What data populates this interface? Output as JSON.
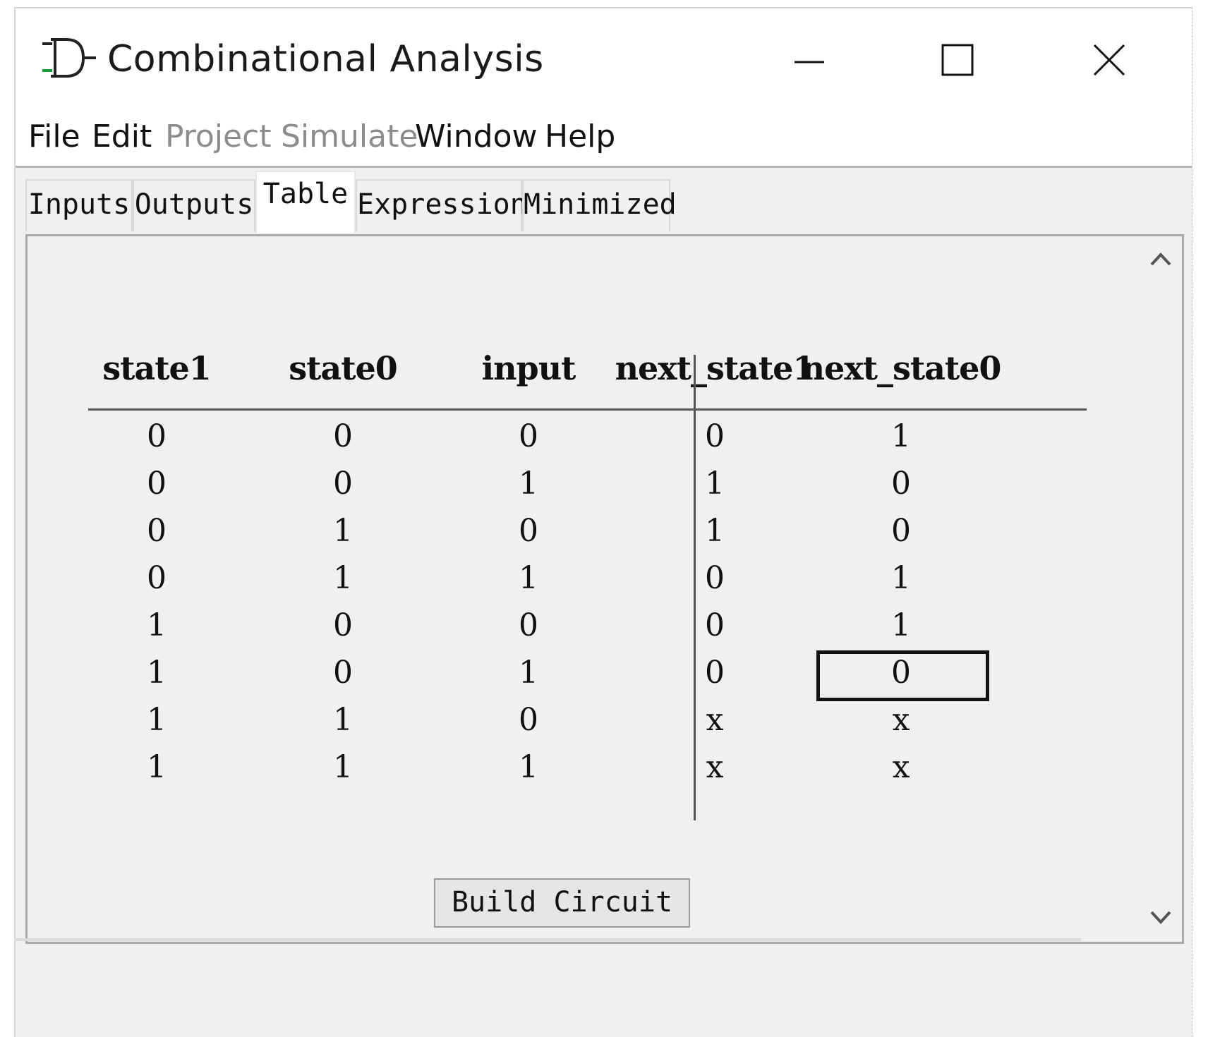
{
  "window": {
    "title": "Combinational Analysis",
    "icon": "gate-icon",
    "controls": [
      "minimize-icon",
      "maximize-icon",
      "close-icon"
    ]
  },
  "menubar": {
    "items": [
      {
        "label": "File",
        "enabled": true
      },
      {
        "label": "Edit",
        "enabled": true
      },
      {
        "label": "Project",
        "enabled": false
      },
      {
        "label": "Simulate",
        "enabled": false
      },
      {
        "label": "Window",
        "enabled": true
      },
      {
        "label": "Help",
        "enabled": true
      }
    ]
  },
  "tabs": [
    {
      "label": "Inputs",
      "active": false
    },
    {
      "label": "Outputs",
      "active": false
    },
    {
      "label": "Table",
      "active": true
    },
    {
      "label": "Expression",
      "active": false
    },
    {
      "label": "Minimized",
      "active": false
    }
  ],
  "truth_table": {
    "input_columns": [
      "state1",
      "state0",
      "input"
    ],
    "output_columns": [
      "next_state1",
      "next_state0"
    ],
    "rows": [
      [
        "0",
        "0",
        "0",
        "0",
        "1"
      ],
      [
        "0",
        "0",
        "1",
        "1",
        "0"
      ],
      [
        "0",
        "1",
        "0",
        "1",
        "0"
      ],
      [
        "0",
        "1",
        "1",
        "0",
        "1"
      ],
      [
        "1",
        "0",
        "0",
        "0",
        "1"
      ],
      [
        "1",
        "0",
        "1",
        "0",
        "0"
      ],
      [
        "1",
        "1",
        "0",
        "x",
        "x"
      ],
      [
        "1",
        "1",
        "1",
        "x",
        "x"
      ]
    ],
    "selected_cell": {
      "row": 5,
      "column": "next_state0"
    }
  },
  "scrollbar": {
    "up_icon": "chevron-up-icon",
    "down_icon": "chevron-down-icon"
  },
  "actions": {
    "build_circuit_label": "Build Circuit"
  }
}
